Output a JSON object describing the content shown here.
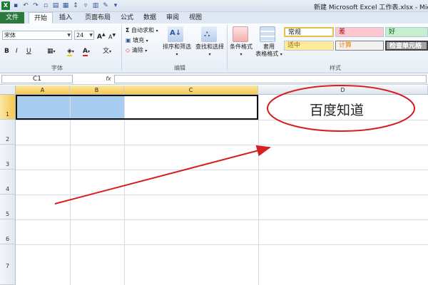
{
  "window": {
    "title": "新建 Microsoft Excel 工作表.xlsx - Microsc"
  },
  "tabs": [
    "文件",
    "开始",
    "插入",
    "页面布局",
    "公式",
    "数据",
    "审阅",
    "视图"
  ],
  "ribbon": {
    "font_name": "宋体",
    "font_size": "24",
    "bold": "B",
    "italic": "I",
    "underline": "U",
    "grow_font": "A",
    "shrink_font": "A",
    "autosum": "自动求和",
    "fill": "填充",
    "clear": "清除",
    "sort_filter": "排序和筛选",
    "find_select": "查找和选择",
    "conditional_format": "条件格式",
    "format_table_line1": "套用",
    "format_table_line2": "表格格式",
    "styles": {
      "normal": "常规",
      "bad": "差",
      "good": "好",
      "neutral": "适中",
      "calc": "计算",
      "check": "检查单元格"
    },
    "groups": {
      "font": "字体",
      "editing": "编辑",
      "styles": "样式"
    }
  },
  "formula_bar": {
    "name_box": "C1",
    "fx": "fx",
    "value": ""
  },
  "grid": {
    "columns": [
      "A",
      "B",
      "C",
      "D"
    ],
    "rows": [
      "1",
      "2",
      "3",
      "4",
      "5",
      "6",
      "7"
    ]
  },
  "annotation": {
    "text": "百度知道",
    "ellipse_color": "#d42020",
    "arrow_color": "#d42020"
  },
  "colors": {
    "file_tab": "#2a7a3b",
    "selected_header": "#f5c84f",
    "cell_fill": "#a9cdf0"
  }
}
